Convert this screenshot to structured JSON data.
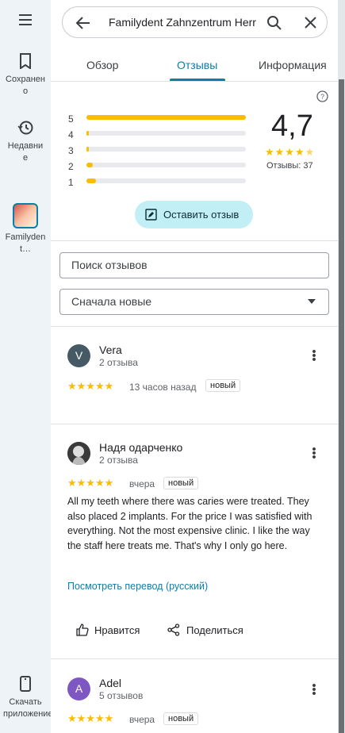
{
  "rail": {
    "saved_label": "Сохранено",
    "recent_label": "Недавние",
    "place_label": "Familydent…",
    "app_label": "Скачать приложение"
  },
  "search": {
    "query": "Familydent Zahnzentrum Herr"
  },
  "tabs": [
    "Обзор",
    "Отзывы",
    "Информация"
  ],
  "active_tab": "Отзывы",
  "summary": {
    "rating": "4,7",
    "reviews_count": "Отзывы: 37",
    "star_rows": [
      {
        "label": "5",
        "fraction": 1.0
      },
      {
        "label": "4",
        "fraction": 0.01
      },
      {
        "label": "3",
        "fraction": 0.01
      },
      {
        "label": "2",
        "fraction": 0.04
      },
      {
        "label": "1",
        "fraction": 0.06
      }
    ],
    "write_review": "Оставить отзыв"
  },
  "filter": {
    "search_placeholder": "Поиск отзывов",
    "sort_selected": "Сначала новые"
  },
  "reviews": [
    {
      "name": "Vera",
      "initial": "V",
      "avatar_color": "#455a64",
      "meta": "2 отзыва",
      "stars": "★★★★★",
      "time": "13 часов назад",
      "badge": "новый"
    },
    {
      "name": "Надя одарченко",
      "meta": "2 отзыва",
      "stars": "★★★★★",
      "time": "вчера",
      "badge": "новый",
      "text": "All my teeth where there was caries were treated. They also placed 2 implants. For the price I was satisfied with everything. Not the most expensive clinic. I like the way the staff here treats me. That's why I only go here.",
      "translate": "Посмотреть перевод (русский)",
      "like": "Нравится",
      "share": "Поделиться"
    },
    {
      "name": "Adel",
      "initial": "A",
      "avatar_color": "#7e57c2",
      "meta": "5 отзывов",
      "stars": "★★★★★",
      "time": "вчера",
      "badge": "новый"
    }
  ]
}
